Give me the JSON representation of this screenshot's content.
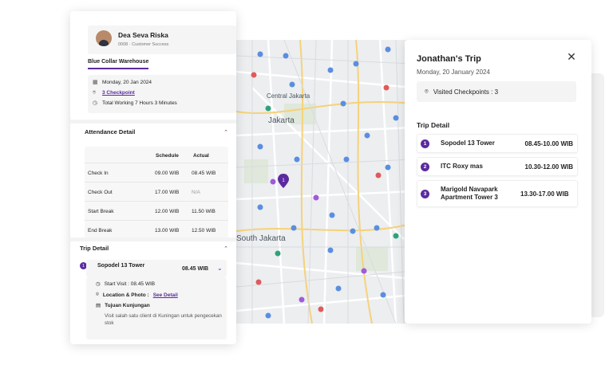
{
  "profile": {
    "name": "Dea Seva Riska",
    "id": "0008",
    "role": "Customer Success"
  },
  "tab_label": "Blue Collar Warehouse",
  "info": {
    "date": "Monday, 20 Jan 2024",
    "checkpoint": "3 Checkpoint",
    "working": "Total Working 7 Hours 3 Minutes"
  },
  "attendance": {
    "title": "Attendance Detail",
    "col_schedule": "Schedule",
    "col_actual": "Actual",
    "rows": [
      {
        "label": "Check In",
        "schedule": "09.00 WIB",
        "actual": "08.45 WIB"
      },
      {
        "label": "Check Out",
        "schedule": "17.00 WIB",
        "actual": "N/A"
      },
      {
        "label": "Start Break",
        "schedule": "12.00 WIB",
        "actual": "11.50 WIB"
      },
      {
        "label": "End Break",
        "schedule": "13.00 WIB",
        "actual": "12.50 WIB"
      }
    ]
  },
  "left_trip": {
    "title": "Trip Detail",
    "item_num": "1",
    "item_name": "Sopodel 13 Tower",
    "item_time": "08.45 WIB",
    "start_visit": "Start Visit : 08.45 WIB",
    "location_label": "Location & Photo :",
    "see_detail": "See Detail",
    "tujuan": "Tujuan Kunjungan",
    "desc": "Visit salah satu client di Kuningan untuk pengecekan stok"
  },
  "map": {
    "labels": [
      "Central Jakarta",
      "Jakarta",
      "South Jakarta"
    ]
  },
  "trip_panel": {
    "title": "Jonathan's Trip",
    "date": "Monday, 20 January 2024",
    "visited": "Visited Checkpoints :  3",
    "detail_title": "Trip Detail",
    "items": [
      {
        "num": "1",
        "name": "Sopodel 13 Tower",
        "time": "08.45-10.00 WIB"
      },
      {
        "num": "2",
        "name": "ITC Roxy mas",
        "time": "10.30-12.00 WIB"
      },
      {
        "num": "3",
        "name": "Marigold Navapark Apartment Tower 3",
        "time": "13.30-17.00 WIB"
      }
    ]
  },
  "colors": {
    "accent": "#5b2a9e"
  }
}
